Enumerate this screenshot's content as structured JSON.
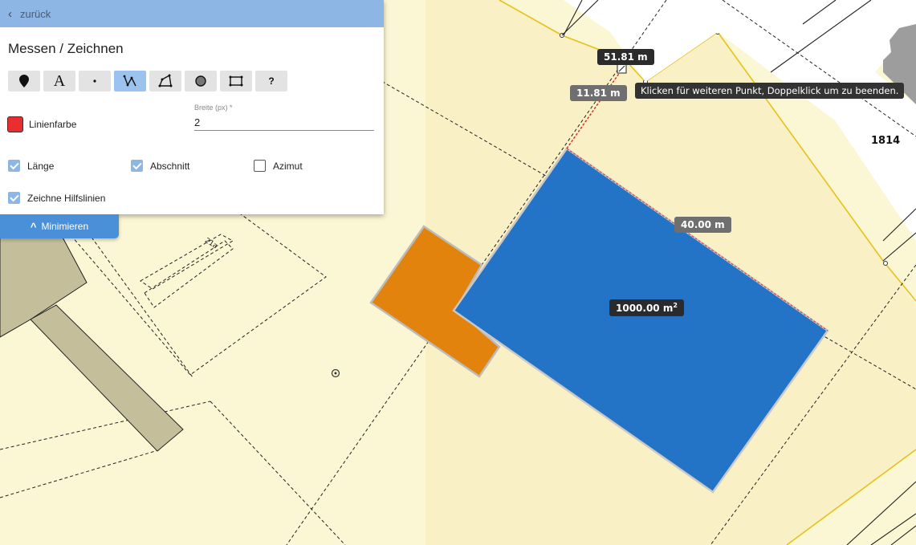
{
  "panel": {
    "back_label": "zurück",
    "title": "Messen / Zeichnen",
    "tools": [
      {
        "name": "marker",
        "icon": "map-marker-icon"
      },
      {
        "name": "text",
        "icon": "text-icon",
        "glyph": "A"
      },
      {
        "name": "point",
        "icon": "point-icon"
      },
      {
        "name": "line",
        "icon": "line-icon"
      },
      {
        "name": "polygon",
        "icon": "polygon-icon"
      },
      {
        "name": "circle",
        "icon": "circle-icon"
      },
      {
        "name": "rectangle",
        "icon": "rectangle-icon"
      },
      {
        "name": "help",
        "icon": "help-icon",
        "glyph": "?"
      }
    ],
    "active_tool": "line",
    "line_color_label": "Linienfarbe",
    "line_color": "#e82e2e",
    "width_label": "Breite (px) *",
    "width_value": "2",
    "checkboxes": {
      "length": {
        "label": "Länge",
        "checked": true
      },
      "segment": {
        "label": "Abschnitt",
        "checked": true
      },
      "azimuth": {
        "label": "Azimut",
        "checked": false
      },
      "helper_lines": {
        "label": "Zeichne Hilfslinien",
        "checked": true
      }
    },
    "minimize_label": "Minimieren"
  },
  "map": {
    "total_length_label": "51.81 m",
    "segment_length_label": "11.81 m",
    "edge_length_label": "40.00 m",
    "area_label": "1000.00 m",
    "area_unit_sup": "2",
    "tooltip": "Klicken für weiteren Punkt, Doppelklick um zu beenden.",
    "parcel_number": "1814",
    "building_number": "21a"
  },
  "colors": {
    "parcel_fill": "#fbf6d3",
    "highlight_parcel_fill": "#f9f0c6",
    "parcel_border_yellow": "#e6c21a",
    "building_grey": "#c4be9a",
    "drawn_rectangle": "#2374c6",
    "orange_building": "#e2830e",
    "measure_line": "#d93030",
    "accent": "#4a90d9"
  }
}
